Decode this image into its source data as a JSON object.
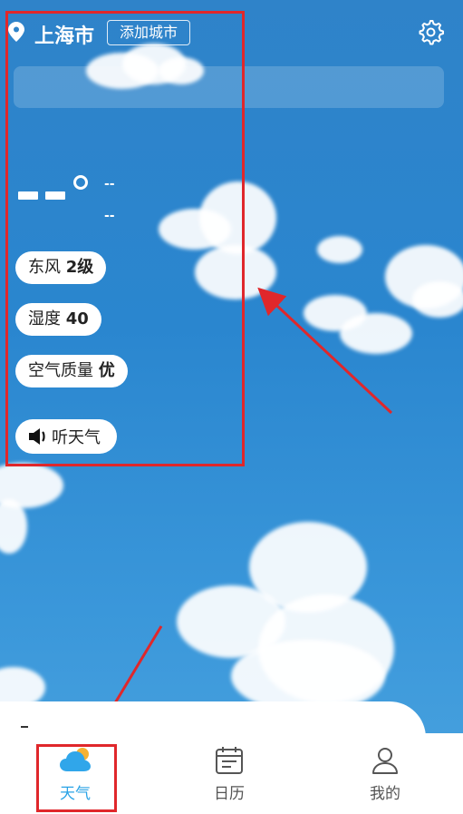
{
  "header": {
    "city": "上海市",
    "add_city_label": "添加城市",
    "location_icon": "location-pin-icon",
    "settings_icon": "gear-icon"
  },
  "weather": {
    "temp_placeholder": "--",
    "mini_top": "--",
    "mini_bottom": "--",
    "wind_label": "东风",
    "wind_value": "2级",
    "humidity_label": "湿度",
    "humidity_value": "40",
    "aqi_label": "空气质量",
    "aqi_value": "优",
    "listen_label": "听天气"
  },
  "tabs": [
    {
      "label": "天气",
      "icon": "weather-cloud-sun-icon",
      "active": true
    },
    {
      "label": "日历",
      "icon": "calendar-icon",
      "active": false
    },
    {
      "label": "我的",
      "icon": "user-icon",
      "active": false
    }
  ],
  "colors": {
    "sky": "#2a86cf",
    "accent": "#2aa3e6",
    "annotation": "#e0272b"
  }
}
